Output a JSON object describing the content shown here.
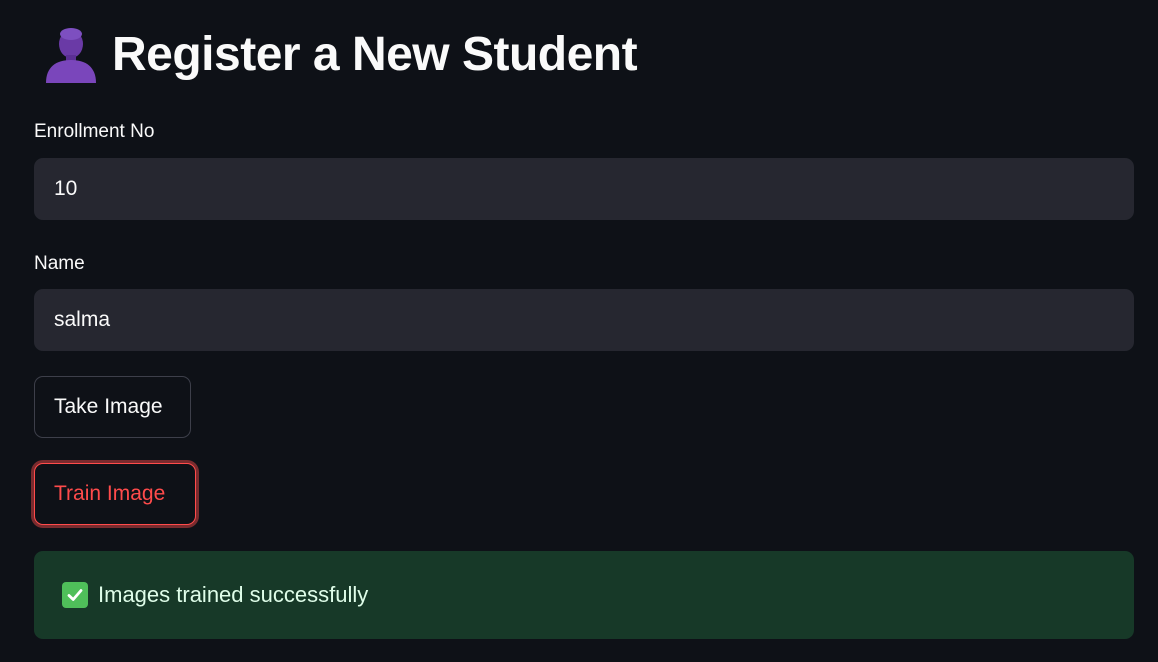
{
  "page": {
    "title": "Register a New Student",
    "title_icon": "person-silhouette-icon"
  },
  "form": {
    "enrollment": {
      "label": "Enrollment No",
      "value": "10"
    },
    "name": {
      "label": "Name",
      "value": "salma"
    }
  },
  "buttons": {
    "take_image": "Take Image",
    "train_image": "Train Image"
  },
  "alert": {
    "text": "Images trained successfully",
    "icon": "check-mark-icon",
    "type": "success"
  },
  "colors": {
    "background": "#0e1117",
    "input_bg": "#262730",
    "accent": "#ff4b4b",
    "success_bg": "#173928",
    "success_text": "#dffde9"
  }
}
